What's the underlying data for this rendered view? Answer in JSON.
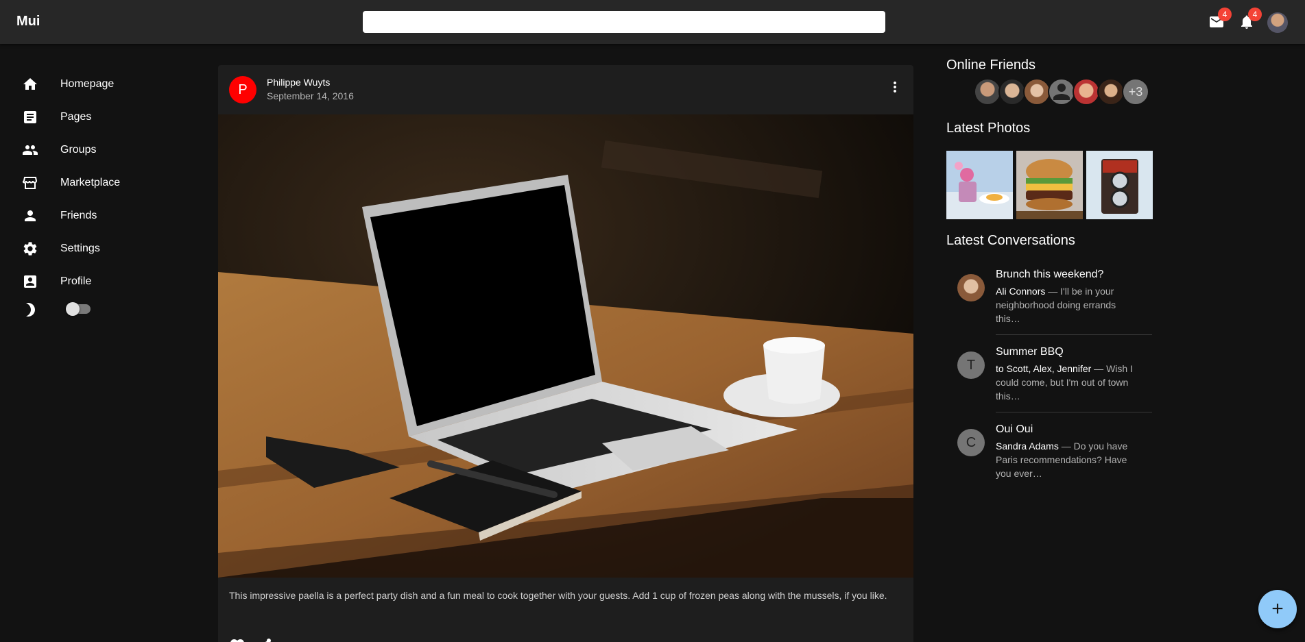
{
  "app": {
    "title": "Mui"
  },
  "search": {
    "value": "",
    "placeholder": ""
  },
  "header": {
    "mail": {
      "icon": "mail-icon",
      "count": "4"
    },
    "notifications": {
      "icon": "bell-icon",
      "count": "4"
    },
    "avatar": "user-avatar"
  },
  "sidebar": {
    "items": [
      {
        "label": "Homepage",
        "icon": "home-icon"
      },
      {
        "label": "Pages",
        "icon": "article-icon"
      },
      {
        "label": "Groups",
        "icon": "group-icon"
      },
      {
        "label": "Marketplace",
        "icon": "storefront-icon"
      },
      {
        "label": "Friends",
        "icon": "person-icon"
      },
      {
        "label": "Settings",
        "icon": "gear-icon"
      },
      {
        "label": "Profile",
        "icon": "account-box-icon"
      }
    ],
    "dark_mode": {
      "icon": "moon-icon",
      "checked": false
    }
  },
  "post": {
    "avatar_letter": "P",
    "avatar_color": "#ff0000",
    "author": "Philippe Wuyts",
    "date": "September 14, 2016",
    "text": "This impressive paella is a perfect party dish and a fun meal to cook together with your guests. Add 1 cup of frozen peas along with the mussels, if you like.",
    "actions": [
      "favorite-icon",
      "share-icon"
    ]
  },
  "right": {
    "online_friends_title": "Online Friends",
    "online_more": "+3",
    "latest_photos_title": "Latest Photos",
    "latest_conversations_title": "Latest Conversations",
    "conversations": [
      {
        "title": "Brunch this weekend?",
        "who": "Ali Connors",
        "text": " — I'll be in your neighborhood doing errands this…",
        "avatar_letter": ""
      },
      {
        "title": "Summer BBQ",
        "who": "to Scott, Alex, Jennifer",
        "text": " — Wish I could come, but I'm out of town this…",
        "avatar_letter": "T"
      },
      {
        "title": "Oui Oui",
        "who": "Sandra Adams",
        "text": " — Do you have Paris recommendations? Have you ever…",
        "avatar_letter": "C"
      }
    ]
  },
  "fab": {
    "label": "+"
  },
  "colors": {
    "appbar": "#272727",
    "background": "#121212",
    "card": "#1e1e1e",
    "badge": "#f44336",
    "fab": "#90caf9"
  }
}
